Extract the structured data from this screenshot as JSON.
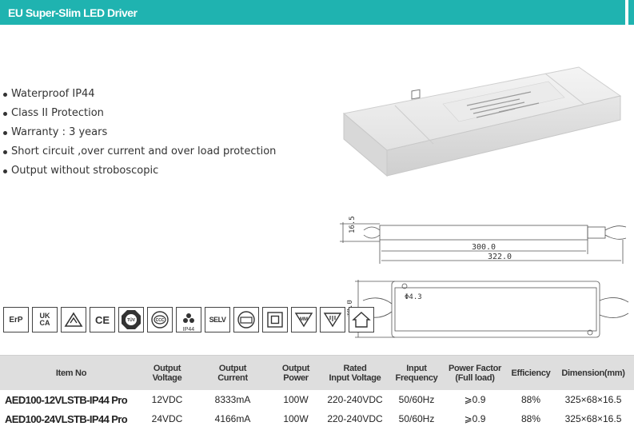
{
  "header": {
    "title": "EU Super-Slim LED Driver"
  },
  "features": [
    "Waterproof IP44",
    "Class II Protection",
    "Warranty : 3 years",
    "Short circuit ,over current and over load protection",
    "Output without stroboscopic"
  ],
  "drawing": {
    "height_dim": "16.5",
    "length_inner": "300.0",
    "length_outer": "322.0",
    "hole_dim": "Φ4.3",
    "width_dim": "70.0"
  },
  "certifications": [
    "ErP",
    "UK CA",
    "RCM",
    "CE",
    "EMC",
    "CCC",
    "IP44",
    "SELV",
    "",
    "",
    "MM",
    "",
    ""
  ],
  "certification_sub": {
    "ip": "IP44"
  },
  "table": {
    "headers": [
      [
        "Item No"
      ],
      [
        "Output",
        "Voltage"
      ],
      [
        "Output",
        "Current"
      ],
      [
        "Output",
        "Power"
      ],
      [
        "Rated",
        "Input Voltage"
      ],
      [
        "Input",
        "Frequency"
      ],
      [
        "Power Factor",
        "(Full load)"
      ],
      [
        "Efficiency"
      ],
      [
        "Dimension(mm)"
      ]
    ],
    "rows": [
      [
        "AED100-12VLSTB-IP44 Pro",
        "12VDC",
        "8333mA",
        "100W",
        "220-240VDC",
        "50/60Hz",
        "⩾0.9",
        "88%",
        "325×68×16.5"
      ],
      [
        "AED100-24VLSTB-IP44 Pro",
        "24VDC",
        "4166mA",
        "100W",
        "220-240VDC",
        "50/60Hz",
        "⩾0.9",
        "88%",
        "325×68×16.5"
      ]
    ]
  },
  "colors": {
    "accent": "#1fb3b0",
    "table_header_bg": "#dedede"
  }
}
